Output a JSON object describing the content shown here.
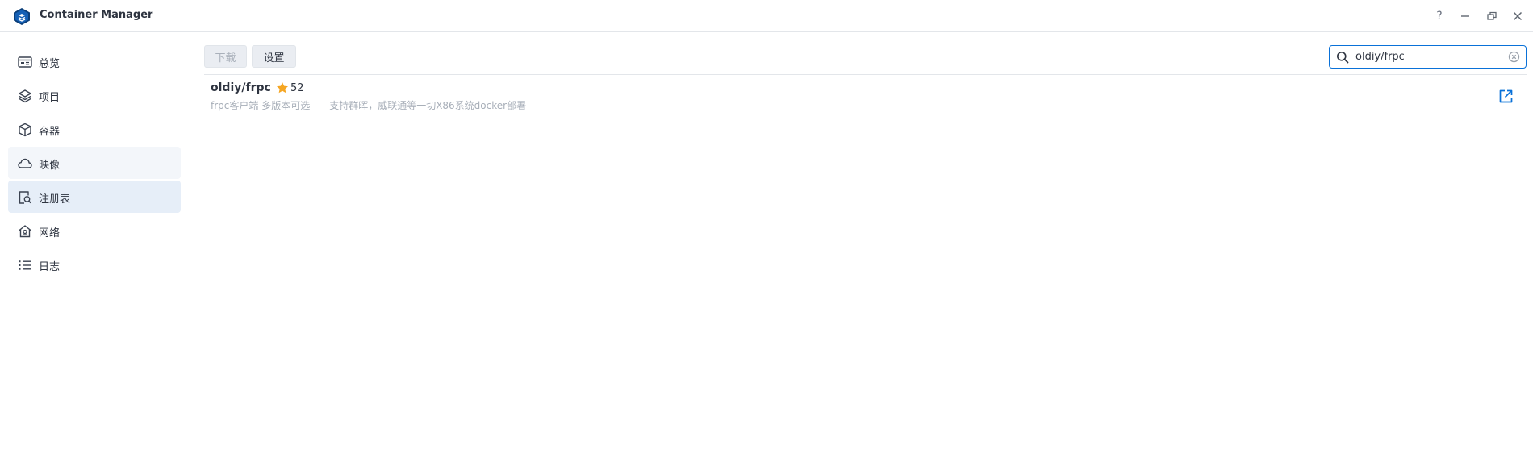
{
  "app": {
    "title": "Container Manager",
    "help_glyph": "?"
  },
  "colors": {
    "accent": "#0a71d8",
    "star": "#f5a623",
    "sidebar_active": "#e6eef8",
    "sidebar_hover": "#f3f6fa"
  },
  "sidebar": {
    "items": [
      {
        "label": "总览",
        "icon": "overview-icon"
      },
      {
        "label": "项目",
        "icon": "project-layers-icon"
      },
      {
        "label": "容器",
        "icon": "container-cube-icon"
      },
      {
        "label": "映像",
        "icon": "image-cloud-icon"
      },
      {
        "label": "注册表",
        "icon": "registry-search-icon"
      },
      {
        "label": "网络",
        "icon": "network-house-icon"
      },
      {
        "label": "日志",
        "icon": "log-list-icon"
      }
    ],
    "active_item": "注册表",
    "hovered_item": "映像"
  },
  "toolbar": {
    "download_label": "下载",
    "settings_label": "设置"
  },
  "search": {
    "value": "oldiy/frpc"
  },
  "results": [
    {
      "name": "oldiy/frpc",
      "stars": "52",
      "description": "frpc客户端 多版本可选——支持群晖，威联通等一切X86系统docker部署"
    }
  ]
}
